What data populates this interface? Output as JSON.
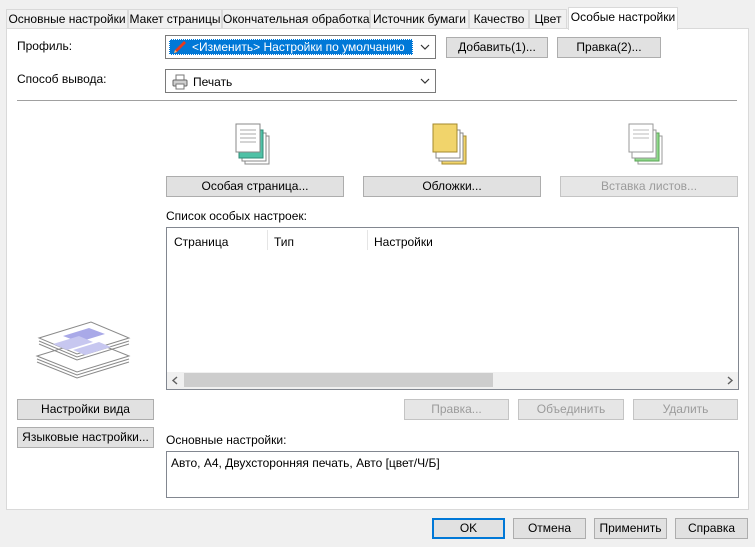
{
  "tabs": [
    {
      "label": "Основные настройки"
    },
    {
      "label": "Макет страницы"
    },
    {
      "label": "Окончательная обработка"
    },
    {
      "label": "Источник бумаги"
    },
    {
      "label": "Качество"
    },
    {
      "label": "Цвет"
    },
    {
      "label": "Особые настройки",
      "active": true
    }
  ],
  "profile": {
    "label": "Профиль:",
    "value": "<Изменить> Настройки по умолчанию",
    "add_button": "Добавить(1)...",
    "edit_button": "Правка(2)..."
  },
  "output": {
    "label": "Способ вывода:",
    "value": "Печать"
  },
  "actions": {
    "special_page": "Особая страница...",
    "covers": "Обложки...",
    "insert_sheets": "Вставка листов..."
  },
  "special_list": {
    "label": "Список особых настроек:",
    "columns": [
      "Страница",
      "Тип",
      "Настройки"
    ],
    "rows": []
  },
  "list_buttons": {
    "edit": "Правка...",
    "merge": "Объединить",
    "delete": "Удалить"
  },
  "left_buttons": {
    "view_settings": "Настройки вида",
    "language_settings": "Языковые настройки..."
  },
  "basic_settings": {
    "label": "Основные настройки:",
    "value": "Авто, A4, Двухсторонняя печать, Авто [цвет/Ч/Б]"
  },
  "footer": {
    "ok": "OK",
    "cancel": "Отмена",
    "apply": "Применить",
    "help": "Справка"
  },
  "colors": {
    "accent": "#0078d7",
    "selection": "#0078d7"
  }
}
